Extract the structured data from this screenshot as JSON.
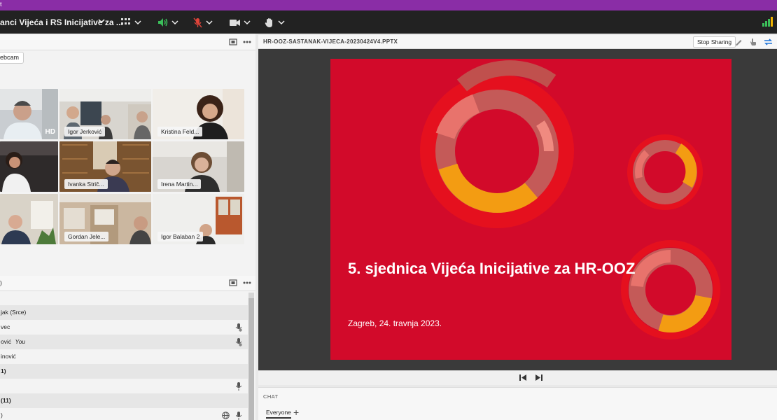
{
  "window": {
    "title_fragment": "t",
    "meeting_title": "anci Vijeća i RS Inicijative za ..."
  },
  "toolbar": {
    "icons": [
      "grid-icon",
      "speaker-icon",
      "mic-off-icon",
      "camera-icon",
      "hand-icon",
      "signal-icon"
    ]
  },
  "webcam": {
    "button_label": "ebcam"
  },
  "videos": [
    {
      "name": "",
      "badge": "HD"
    },
    {
      "name": "Igor Jerković"
    },
    {
      "name": "Kristina Feld..."
    },
    {
      "name": ""
    },
    {
      "name": "Ivanka Strič..."
    },
    {
      "name": "Irena Martin..."
    },
    {
      "name": ""
    },
    {
      "name": "Gordan Jele..."
    },
    {
      "name": "Igor Balaban 2"
    }
  ],
  "attendees": {
    "header": ")",
    "rows": [
      {
        "text": "jak (Srce)"
      },
      {
        "text": "vec"
      },
      {
        "text": "ović",
        "suffix": "You"
      },
      {
        "text": "inović"
      },
      {
        "text": "1)"
      },
      {
        "text": ""
      },
      {
        "text": "(11)"
      },
      {
        "text": ")"
      }
    ]
  },
  "share": {
    "filename": "HR-OOZ-SASTANAK-VIJECA-20230424V4.PPTX",
    "stop_label": "Stop Sharing",
    "slide_title": "5. sjednica Vijeća Inicijative za HR-OOZ",
    "slide_subtitle": "Zagreb, 24. travnja 2023.",
    "colors": {
      "background": "#d20a2a",
      "orange": "#f39c12",
      "salmon": "#e8736c",
      "mauve": "#c45a58"
    }
  },
  "chat": {
    "header": "CHAT",
    "tab": "Everyone",
    "add_label": "+"
  }
}
